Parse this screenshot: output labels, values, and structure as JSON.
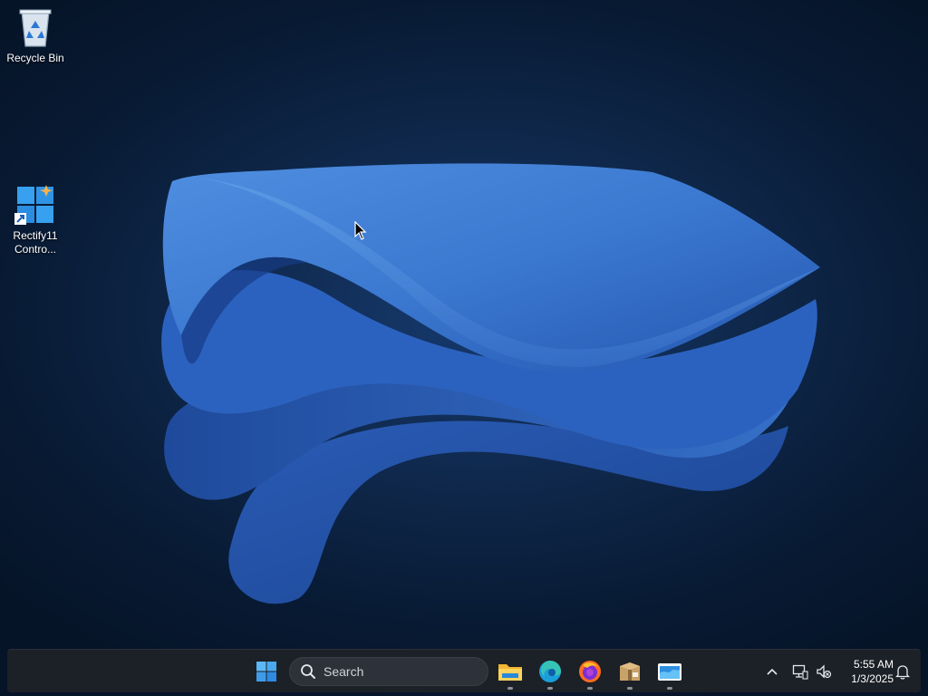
{
  "desktop": {
    "icons": [
      {
        "label": "Recycle Bin",
        "icon": "recycle-bin-icon"
      },
      {
        "label": "Rectify11 Contro...",
        "label_line1": "Rectify11",
        "label_line2": "Contro...",
        "icon": "rectify11-control-panel-icon"
      }
    ]
  },
  "taskbar": {
    "start_icon": "windows-start-icon",
    "search": {
      "label": "Search",
      "icon": "search-icon"
    },
    "pinned_apps": [
      {
        "name": "File Explorer",
        "icon": "file-explorer-icon",
        "running": true
      },
      {
        "name": "Microsoft Edge",
        "icon": "edge-icon",
        "running": true
      },
      {
        "name": "Firefox",
        "icon": "firefox-icon",
        "running": true
      },
      {
        "name": "Package app",
        "icon": "package-icon",
        "running": true
      },
      {
        "name": "Control app",
        "icon": "control-panel-icon",
        "running": true
      }
    ],
    "tray": {
      "overflow_icon": "chevron-up-icon",
      "network_icon": "network-icon",
      "volume_icon": "volume-muted-icon",
      "notification_icon": "bell-icon"
    },
    "clock": {
      "time": "5:55 AM",
      "date": "1/3/2025"
    }
  },
  "colors": {
    "accent": "#3a7bd5",
    "taskbar_bg": "#1c2027",
    "desktop_bg": "#0b1e3c"
  }
}
